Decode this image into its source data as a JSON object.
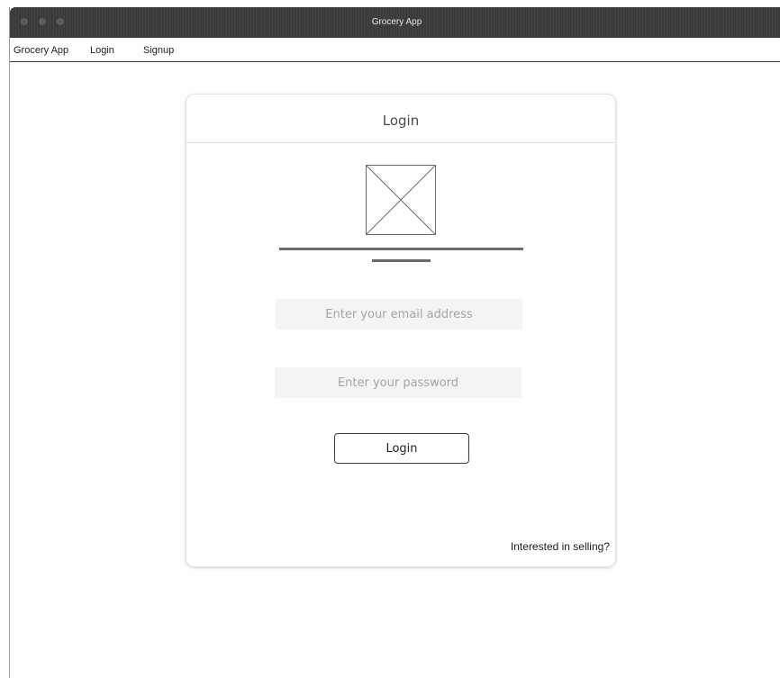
{
  "window": {
    "title": "Grocery App"
  },
  "menubar": {
    "items": [
      {
        "label": "Grocery App"
      },
      {
        "label": "Login"
      },
      {
        "label": "Signup"
      }
    ]
  },
  "login_card": {
    "title": "Login",
    "image_icon": "image-placeholder-icon",
    "email_field": {
      "placeholder": "Enter your email address",
      "value": ""
    },
    "password_field": {
      "placeholder": "Enter your password",
      "value": ""
    },
    "login_button_label": "Login",
    "selling_link_label": "Interested in selling?"
  },
  "colors": {
    "titlebar": "#3a3a3a",
    "field_background": "#f4f4f4",
    "divider": "#6b6b6b"
  }
}
